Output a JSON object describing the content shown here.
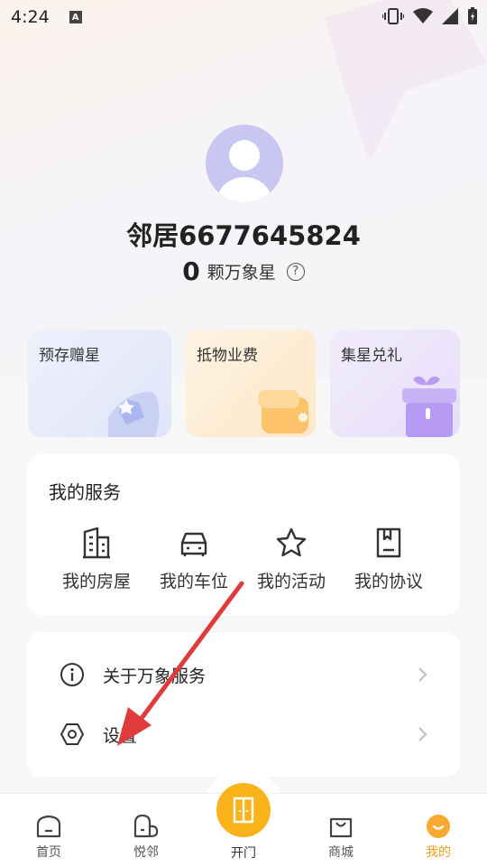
{
  "status_bar": {
    "time": "4:24",
    "a_badge": "A"
  },
  "profile": {
    "name": "邻居6677645824",
    "stars_count": "0",
    "stars_label": "颗万象星",
    "help": "?"
  },
  "cards": [
    {
      "title": "预存赠星"
    },
    {
      "title": "抵物业费"
    },
    {
      "title": "集星兑礼"
    }
  ],
  "services": {
    "title": "我的服务",
    "items": [
      {
        "label": "我的房屋",
        "icon": "building-icon"
      },
      {
        "label": "我的车位",
        "icon": "car-icon"
      },
      {
        "label": "我的活动",
        "icon": "star-icon"
      },
      {
        "label": "我的协议",
        "icon": "document-icon"
      }
    ]
  },
  "menu": [
    {
      "label": "关于万象服务",
      "icon": "info-icon"
    },
    {
      "label": "设置",
      "icon": "hexagon-settings-icon"
    }
  ],
  "tabbar": {
    "items": [
      {
        "label": "首页",
        "icon": "home-icon"
      },
      {
        "label": "悦邻",
        "icon": "neighbor-icon"
      },
      {
        "label": "开门",
        "icon": "door-icon"
      },
      {
        "label": "商城",
        "icon": "shopping-bag-icon"
      },
      {
        "label": "我的",
        "icon": "profile-smile-icon",
        "active": true
      }
    ],
    "active_color": "#f4a21a",
    "open_button_color": "#fbb31b"
  },
  "annotation": {
    "arrow_color": "#e03b3b"
  }
}
